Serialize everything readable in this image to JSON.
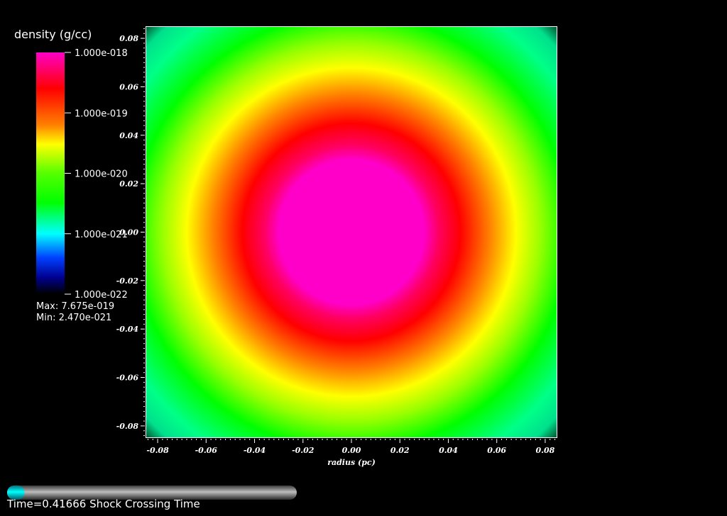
{
  "chart_data": {
    "type": "heatmap",
    "title": "",
    "xlabel": "radius (pc)",
    "ylabel": "",
    "xlim": [
      -0.085,
      0.085
    ],
    "ylim": [
      -0.085,
      0.085
    ],
    "x_ticks": [
      -0.08,
      -0.06,
      -0.04,
      -0.02,
      0.0,
      0.02,
      0.04,
      0.06,
      0.08
    ],
    "x_tick_labels": [
      "-0.08",
      "-0.06",
      "-0.04",
      "-0.02",
      "0.00",
      "0.02",
      "0.04",
      "0.06",
      "0.08"
    ],
    "y_ticks": [
      -0.08,
      -0.06,
      -0.04,
      -0.02,
      0.0,
      0.02,
      0.04,
      0.06,
      0.08
    ],
    "y_tick_labels": [
      "-0.08",
      "-0.06",
      "-0.04",
      "-0.02",
      "0.00",
      "0.02",
      "0.04",
      "0.06",
      "0.08"
    ],
    "colorbar": {
      "title": "density (g/cc)",
      "scale": "log",
      "range": [
        1e-22,
        1e-18
      ],
      "tick_values": [
        1e-18,
        1e-19,
        1e-20,
        1e-21,
        1e-22
      ],
      "tick_labels": [
        "1.000e-018",
        "1.000e-019",
        "1.000e-020",
        "1.000e-021",
        "1.000e-022"
      ],
      "colormap": [
        {
          "frac": 0.0,
          "color": "#ff00c8"
        },
        {
          "frac": 0.15,
          "color": "#ff0000"
        },
        {
          "frac": 0.3,
          "color": "#ff8000"
        },
        {
          "frac": 0.38,
          "color": "#ffff00"
        },
        {
          "frac": 0.5,
          "color": "#55ff00"
        },
        {
          "frac": 0.62,
          "color": "#00ff00"
        },
        {
          "frac": 0.75,
          "color": "#00ffff"
        },
        {
          "frac": 0.85,
          "color": "#0040ff"
        },
        {
          "frac": 0.93,
          "color": "#000090"
        },
        {
          "frac": 1.0,
          "color": "#000000"
        }
      ]
    },
    "max_label": "Max:  7.675e-019",
    "min_label": "Min:  2.470e-021",
    "density_field": {
      "center": [
        0.0,
        0.0
      ],
      "radial_profile": [
        {
          "r": 0.0,
          "color": "#ff00c8"
        },
        {
          "r": 0.03,
          "color": "#ff00c8"
        },
        {
          "r": 0.036,
          "color": "#ff0060"
        },
        {
          "r": 0.045,
          "color": "#ff0000"
        },
        {
          "r": 0.057,
          "color": "#ff8000"
        },
        {
          "r": 0.068,
          "color": "#ffff00"
        },
        {
          "r": 0.078,
          "color": "#99ff00"
        },
        {
          "r": 0.09,
          "color": "#00ff00"
        },
        {
          "r": 0.105,
          "color": "#00ff88"
        },
        {
          "r": 0.114,
          "color": "#00e08c"
        },
        {
          "r": 0.12,
          "color": "#005530"
        },
        {
          "r": 0.1203,
          "color": "#000000"
        }
      ]
    }
  },
  "time_annotation": {
    "text": "Time=0.41666 Shock Crossing Time",
    "progress": 0.06
  }
}
